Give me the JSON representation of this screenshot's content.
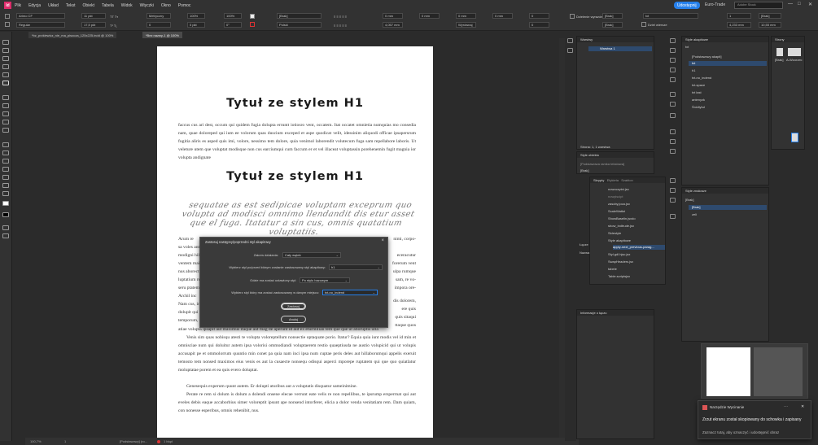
{
  "menubar": {
    "logo": "Id",
    "items": [
      "Plik",
      "Edycja",
      "Układ",
      "Tekst",
      "Obiekt",
      "Tabela",
      "Widok",
      "Wtyczki",
      "Okno",
      "Pomoc"
    ],
    "share_button": "Udostępnij",
    "workspace": "Euro-Trade",
    "search_placeholder": "Adobe Stock"
  },
  "controlbar": {
    "font_family": "Arimo CF",
    "font_style": "Regular",
    "font_size": "11 pkt",
    "leading": "17,5 pkt",
    "kerning": "Metryczny",
    "tracking": "0",
    "scale_v": "100%",
    "scale_h": "100%",
    "baseline": "0 pkt",
    "skew": "0°",
    "char_style": "[Brak]",
    "language": "Polski",
    "indent_left": "0 mm",
    "indent_right": "0 mm",
    "indent_first": "4,057 mm",
    "space_before": "0 mm",
    "space_after": "0 mm",
    "alignment": "Wyrównaj",
    "drop_lines": "0",
    "drop_chars": "0",
    "hyphenation": "Dzielenie wyrazów",
    "balance": "Wyrównanie",
    "grid_checkbox": "Dziel wiersze",
    "para_style": "txt",
    "columns": "1",
    "gutter": "4,233 mm",
    "col_width": "10,55 mm",
    "none1": "[Brak]",
    "none2": "[Brak]"
  },
  "tabs": [
    "*bz_przkiewicz_nie_ma_pisocza_125x225.indd @ 100%",
    "*Bez nazwy-1 @ 100%"
  ],
  "page": {
    "heading1": "Tytuł ze stylem H1",
    "para1": "faccus cus ari dest, occum qui quidem fugia dolupta erruntt iotiosro vent, occatem. Itat occatet omnietia numquias mo consedia nam, quae doloreped qui ium ee volorum quas duscium exceped et aspe quodicat velit, idessinim aliquodi officae ipsapersrum fugitia aliris es asped quis imi, volore, nessimo tem dolore, quia venimol laborendit volutecum fuga sam repellabore laboris. Ut veleture utem que voluptat modisque non cus earciumqui cum faccum er et vel illaceat voluptassin porehenemin fugit magnia ior volupta andignate",
    "heading2": "Tytuł ze stylem H1",
    "script": "sequatae as est sedipicae voluptam exceprum quo volupta ad modisci omnimo llendandit dis etur asset que el fuga. Itatatur a sin cus, omnis quatatium voluptatiis.",
    "para2_start": "Arum re",
    "para2_right": "nimi, corpo-",
    "para3_tail": "atiae volupta ipsapit aut maximus itaque aut mag de aperunt id aut ex eturmilian tem que que ut aboruptis ulla",
    "para4": "Venis sim quas nobisqu atesti te volupta voloreptellum nonsectie optaquate porio. Itatur? Equia quia iunt modis vel id min et omnisciae num qui doluitur autem ipsa volorisi ommodiandi voluptaerem restio quaeptiusda ne austio volupicid qui ut volupis accusapit pe et ommolorrum quuntio min conet pa quia nam inci ipsa num cuptae peris deles aut hillaborumqui appelis exeruit temosto tem nonsed maximos eius venis es aut la cusaecte nonsequ odisqui asperci mporepe ruptatem qui que quo quiatlatur moluptatae porem et ea quis evero doluptat.",
    "para5": "Genesequis experum quunt autem. Er dolupti aturibus aut a voluptatis disquatur sameinimine.",
    "para6": "Perate re rem si dolum is dolum a dolendi onsene elecae verrunt eate velis re non repellibus, te ipsrump ersperrnat qui aut eveles debis eaque accaborbius simer voloreptit ipsunt ape nonsend intorferer, elicia a dolor venda venitatiam rem. Dam quiam, con nonesse esperibus, omnis rehenibit, nus.",
    "left_col": [
      "sa voles ant",
      "modigni hil",
      "ventem maior,",
      "nus aborect",
      "luptatium re",
      "seru ptatem",
      "Archil inc",
      "Nam cus, in",
      "dolupit qui",
      "temporum,"
    ],
    "right_col": [
      "eceracutur",
      "forerum vent",
      "ulpa rumque",
      "sam, re vo-",
      "impora ore-",
      "dis dolorem,",
      "ere quis",
      "quis sitaqui",
      "ttaque quos"
    ]
  },
  "dialog": {
    "title": "Zastosuj następny/poprzedni styl akapitowy",
    "scope_label": "Zakres działania:",
    "scope_value": "Cały wątek",
    "target_style_label": "Wybierz styl po/przed którym zostanie zastosowany styl akapitowy:",
    "target_style_value": "h1",
    "where_label": "Gdzie ma zostać ustawiony styl:",
    "where_value": "Po stylu bazowym",
    "apply_style_label": "Wybierz styl który ma zostać zastosowany w danym miejscu:",
    "apply_style_value": "txt-no_indend",
    "apply_button": "Zastosuj",
    "cancel_button": "Anuluj"
  },
  "statusbar": {
    "zoom": "100,7%",
    "page": "1",
    "layout": "[Podstawowy] (ro...",
    "errors": "1 błąd"
  },
  "layers_panel": {
    "title": "Warstwy",
    "layer": "Warstwa 1",
    "footer": "Strona: 1, 1 warstwa"
  },
  "object_styles_panel": {
    "title": "Style obiektu",
    "items": [
      "[Podstawowa ramka tekstowa]",
      "[Brak]"
    ]
  },
  "scripts_panel": {
    "tabs": [
      "Skrypty",
      "Etykieta",
      "Szablon"
    ],
    "items": [
      "nowoczytni.jsx",
      "nowyiscipt",
      "zasoby.joca.jsx",
      "ScaleWatkri",
      "ShowBaselin.jsxdo",
      "show_indtrude.jsx",
      "Sidestyle",
      "Style akapitowe",
      "apply-next_previous-parag...",
      "Styl.gdl.hjsc.jsx",
      "SwapHeaders.jsx",
      "tabele",
      "Table.scriptsjsx"
    ]
  },
  "effects_panel": {
    "label1": "Łącze",
    "label2": "Nazwa"
  },
  "info_panel": {
    "title": "Informacje o łączu"
  },
  "para_styles_panel": {
    "title": "Style akapitowe",
    "current": "txt",
    "items": [
      "[Podstawowy akapit]",
      "txt",
      "h1",
      "txt-no_indend",
      "txt-space",
      "txt last",
      "antenyzk",
      "Śródtytuł"
    ]
  },
  "swatches_panel": {
    "title": "Strony",
    "items": [
      "[Brak]",
      "A-Wzorzec"
    ]
  },
  "char_styles_panel": {
    "title": "Style znakowe",
    "current": "[Brak]",
    "items": [
      "[Brak]",
      "zeli"
    ]
  },
  "notification": {
    "app": "Narzędzie Wycinanie",
    "line1": "Zrzut ekranu został skopiowany do schowka i zapisany",
    "line2": "Zaznacz tutaj, aby oznaczyć i udostępnić obraz"
  },
  "colors": {
    "accent": "#2680eb",
    "selected_row": "#2e4a6e",
    "brand": "#de2d6b",
    "panel_bg": "#323232"
  }
}
